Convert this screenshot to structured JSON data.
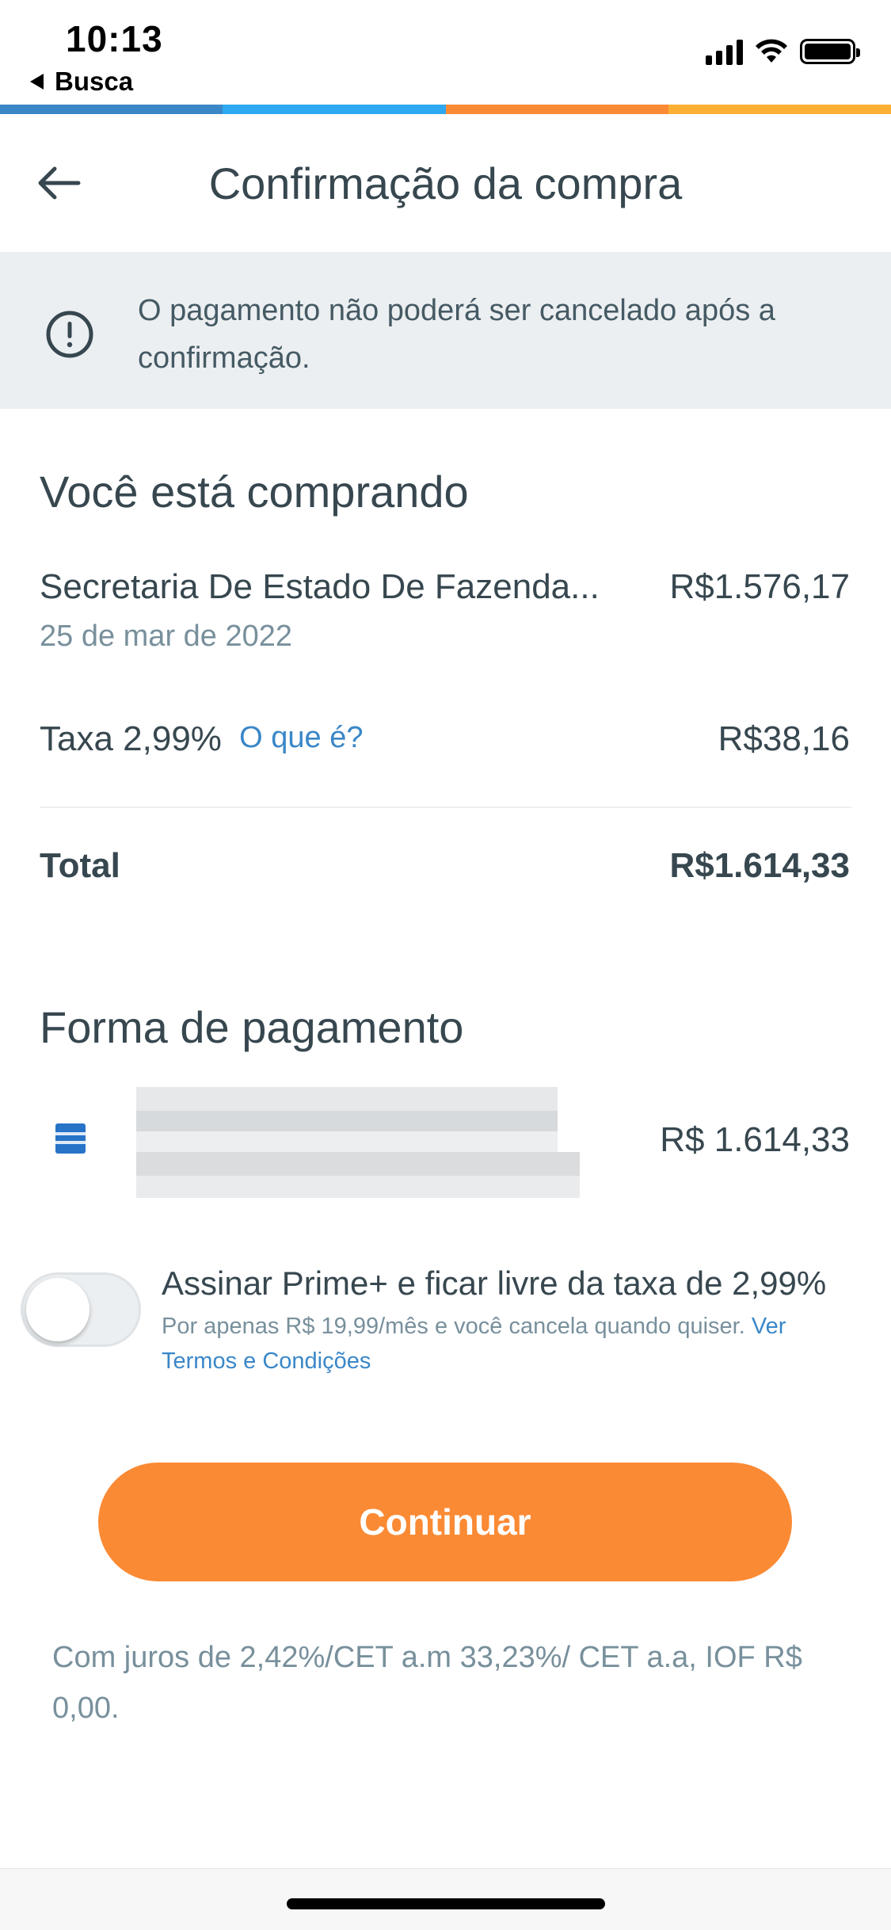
{
  "status_bar": {
    "time": "10:13",
    "back_label": "Busca",
    "icons": [
      "signal-icon",
      "wifi-icon",
      "battery-icon"
    ]
  },
  "color_strip": [
    "#3a87c8",
    "#2ea8f0",
    "#fb8a34",
    "#fbb034"
  ],
  "header": {
    "title": "Confirmação da compra",
    "back_icon": "arrow-left-icon"
  },
  "warning": {
    "icon": "alert-circle-icon",
    "text_line1": "O pagamento não poderá ser cancelado após a",
    "text_line2": "confirmação."
  },
  "purchase": {
    "section_title": "Você está comprando",
    "merchant": "Secretaria De Estado De Fazenda...",
    "merchant_amount": "R$1.576,17",
    "date": "25 de mar de 2022",
    "fee_label": "Taxa 2,99%",
    "fee_link": "O que é?",
    "fee_amount": "R$38,16",
    "total_label": "Total",
    "total_amount": "R$1.614,33"
  },
  "payment": {
    "section_title": "Forma de pagamento",
    "card_icon": "amex-card-icon",
    "amount": "R$ 1.614,33"
  },
  "prime": {
    "toggle_on": false,
    "title": "Assinar Prime+ e ficar livre da taxa de 2,99%",
    "desc": "Por apenas R$ 19,99/mês e você cancela quando quiser.",
    "link_part1": "Ver",
    "link_part2": "Termos e Condições"
  },
  "actions": {
    "continue_label": "Continuar"
  },
  "footnote": {
    "line1": "Com juros de 2,42%/CET a.m 33,23%/ CET a.a, IOF R$",
    "line2": "0,00."
  },
  "colors": {
    "primary_text": "#37474f",
    "muted_text": "#78909c",
    "link": "#3a87c8",
    "accent_orange": "#fb8a34",
    "banner_bg": "#eceff1"
  }
}
